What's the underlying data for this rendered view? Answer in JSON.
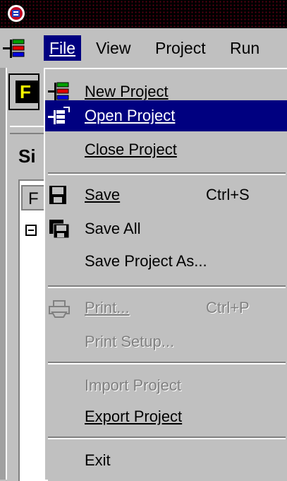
{
  "menubar": {
    "file": "File",
    "view": "View",
    "project": "Project",
    "run": "Run"
  },
  "background": {
    "yellow_button_text": "F",
    "panel_label": "Si",
    "tab_label": "F"
  },
  "file_menu": {
    "new_project": "New Project",
    "open_project": "Open Project",
    "close_project": "Close Project",
    "save": "Save",
    "save_shortcut": "Ctrl+S",
    "save_all": "Save All",
    "save_project_as": "Save Project As...",
    "print": "Print...",
    "print_shortcut": "Ctrl+P",
    "print_setup": "Print Setup...",
    "import_project": "Import Project",
    "export_project": "Export Project",
    "exit": "Exit"
  },
  "colors": {
    "highlight": "#000080",
    "face": "#c0c0c0",
    "disabled": "#808080"
  }
}
